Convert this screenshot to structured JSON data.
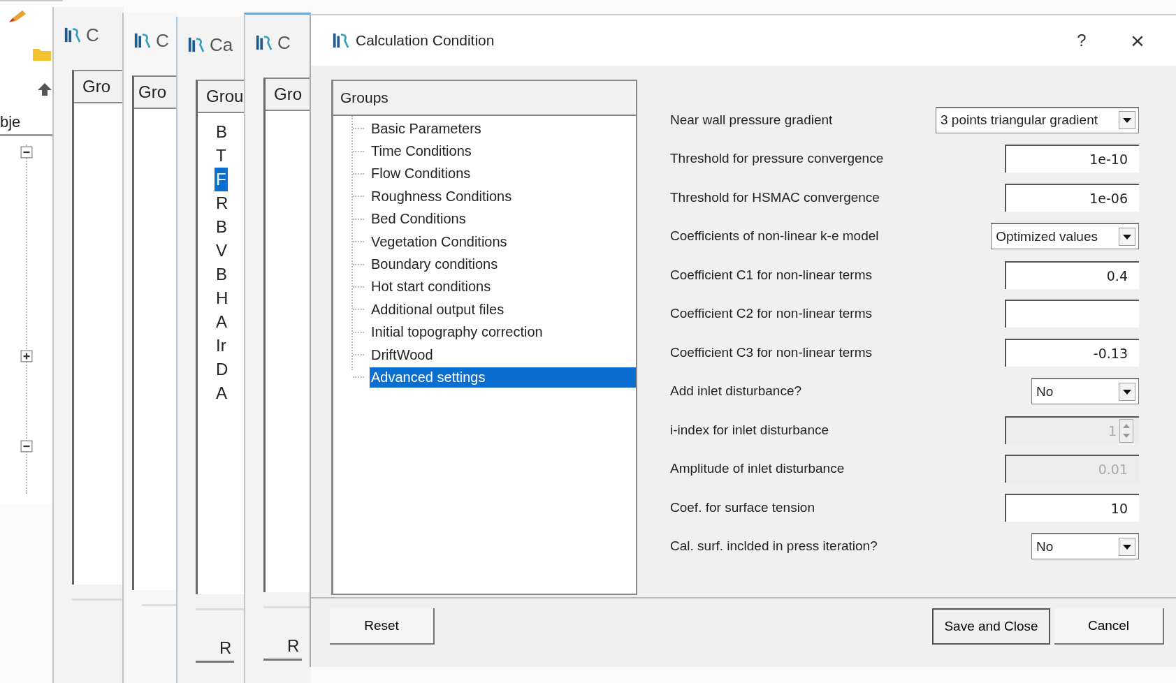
{
  "app_window": {
    "panel_label": "bje"
  },
  "background_windows": [
    {
      "title": "C",
      "groups_header": "Gro"
    },
    {
      "title": "C",
      "groups_header": "Gro"
    },
    {
      "title": "Ca",
      "groups_header": "Grou",
      "tree_items": [
        {
          "label": "B",
          "selected": false
        },
        {
          "label": "T",
          "selected": false
        },
        {
          "label": "F",
          "selected": true
        },
        {
          "label": "R",
          "selected": false
        },
        {
          "label": "B",
          "selected": false
        },
        {
          "label": "V",
          "selected": false
        },
        {
          "label": "B",
          "selected": false
        },
        {
          "label": "H",
          "selected": false
        },
        {
          "label": "A",
          "selected": false
        },
        {
          "label": "Ir",
          "selected": false
        },
        {
          "label": "D",
          "selected": false
        },
        {
          "label": "A",
          "selected": false
        }
      ],
      "button": "R"
    },
    {
      "title": "C",
      "groups_header": "Gro",
      "button": "R"
    }
  ],
  "dialog": {
    "title": "Calculation Condition",
    "help": "?",
    "close": "×",
    "groups": {
      "header": "Groups",
      "items": [
        {
          "label": "Basic Parameters",
          "selected": false
        },
        {
          "label": "Time Conditions",
          "selected": false
        },
        {
          "label": "Flow Conditions",
          "selected": false
        },
        {
          "label": "Roughness Conditions",
          "selected": false
        },
        {
          "label": "Bed Conditions",
          "selected": false
        },
        {
          "label": "Vegetation Conditions",
          "selected": false
        },
        {
          "label": "Boundary conditions",
          "selected": false
        },
        {
          "label": "Hot start conditions",
          "selected": false
        },
        {
          "label": "Additional output files",
          "selected": false
        },
        {
          "label": "Initial topography correction",
          "selected": false
        },
        {
          "label": "DriftWood",
          "selected": false
        },
        {
          "label": "Advanced settings",
          "selected": true
        }
      ]
    },
    "settings": [
      {
        "kind": "combo",
        "label": "Near wall pressure gradient",
        "value": "3 points triangular gradient",
        "disabled": false
      },
      {
        "kind": "text",
        "label": "Threshold for pressure convergence",
        "value": "1e-10",
        "disabled": false
      },
      {
        "kind": "text",
        "label": "Threshold for HSMAC convergence",
        "value": "1e-06",
        "disabled": false
      },
      {
        "kind": "combo",
        "label": "Coefficients of non-linear k-e model",
        "value": "Optimized values",
        "disabled": false
      },
      {
        "kind": "text",
        "label": "Coefficient C1 for non-linear terms",
        "value": "0.4",
        "disabled": false
      },
      {
        "kind": "text",
        "label": "Coefficient C2 for non-linear terms",
        "disabled": false
      },
      {
        "kind": "text",
        "label": "Coefficient C3 for non-linear terms",
        "value": "-0.13",
        "disabled": false
      },
      {
        "kind": "combo",
        "label": "Add inlet disturbance?",
        "value": "No",
        "disabled": false
      },
      {
        "kind": "spin",
        "label": "i-index for inlet disturbance",
        "value": "1",
        "disabled": true
      },
      {
        "kind": "text",
        "label": "Amplitude of inlet disturbance",
        "value": "0.01",
        "disabled": true
      },
      {
        "kind": "text",
        "label": "Coef. for surface tension",
        "value": "10",
        "disabled": false
      },
      {
        "kind": "combo",
        "label": "Cal. surf. inclded in press iteration?",
        "value": "No",
        "disabled": false
      }
    ],
    "buttons": {
      "reset": "Reset",
      "save": "Save and Close",
      "cancel": "Cancel"
    }
  }
}
